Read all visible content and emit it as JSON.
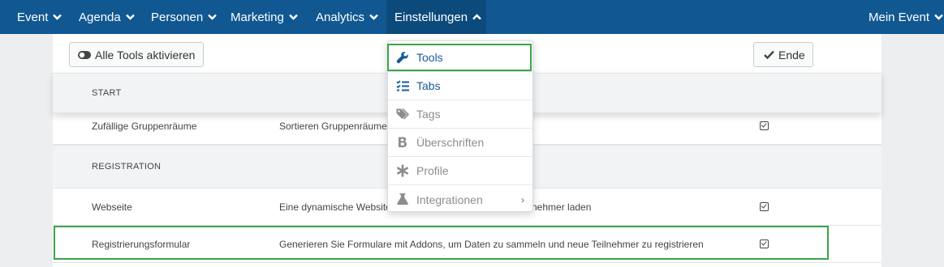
{
  "nav": {
    "items": [
      {
        "label": "Event"
      },
      {
        "label": "Agenda"
      },
      {
        "label": "Personen"
      },
      {
        "label": "Marketing"
      },
      {
        "label": "Analytics"
      },
      {
        "label": "Einstellungen"
      }
    ],
    "right_label": "Mein Event"
  },
  "toolbar": {
    "activate_all_label": "Alle Tools aktivieren",
    "end_label": "Ende"
  },
  "sections": {
    "start": {
      "heading": "START",
      "rows": [
        {
          "name": "Zufällige Gruppenräume",
          "description": "Sortieren Gruppenräume",
          "enabled": true
        }
      ]
    },
    "registration": {
      "heading": "REGISTRATION",
      "rows": [
        {
          "name": "Webseite",
          "description": "Eine dynamische Website",
          "description_tail": "nehmer laden",
          "enabled": true
        },
        {
          "name": "Registrierungsformular",
          "description": "Generieren Sie Formulare mit Addons, um Daten zu sammeln und neue Teilnehmer zu registrieren",
          "enabled": true
        }
      ]
    }
  },
  "dropdown": {
    "items": [
      {
        "label": "Tools",
        "icon": "wrench-icon",
        "state": "enabled"
      },
      {
        "label": "Tabs",
        "icon": "list-check-icon",
        "state": "enabled"
      },
      {
        "label": "Tags",
        "icon": "tags-icon",
        "state": "disabled"
      },
      {
        "label": "Überschriften",
        "icon": "bold-icon",
        "state": "disabled"
      },
      {
        "label": "Profile",
        "icon": "asterisk-icon",
        "state": "disabled"
      },
      {
        "label": "Integrationen",
        "icon": "flask-icon",
        "state": "disabled",
        "submenu_arrow": "›"
      }
    ]
  },
  "colors": {
    "nav_bg": "#115892",
    "highlight": "#3aa54b",
    "link": "#175b94"
  }
}
